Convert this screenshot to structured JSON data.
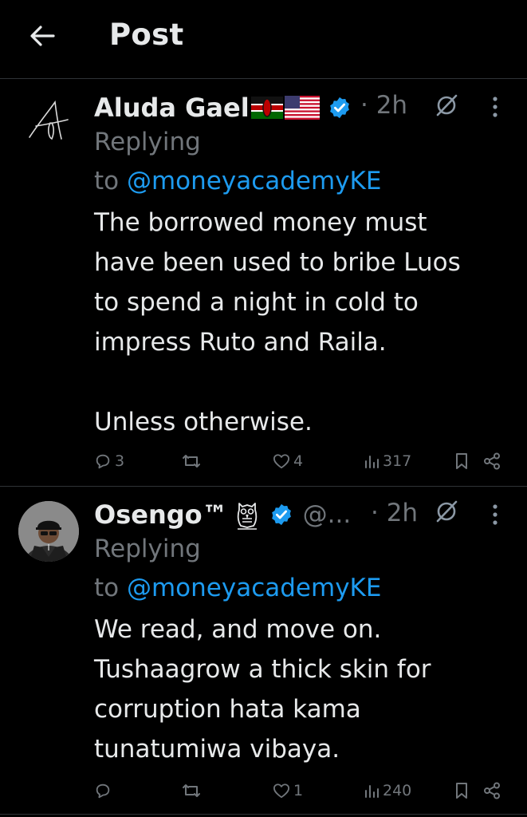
{
  "header": {
    "title": "Post"
  },
  "tweets": [
    {
      "name": "Aluda Gael",
      "handle": "",
      "time": "· 2h",
      "replying": "Replying",
      "to_prefix": "to",
      "mention": "@moneyacademyKE",
      "lines": [
        "The borrowed money must",
        "have been used to bribe Luos",
        "to spend a night in cold to",
        "impress Ruto and Raila.",
        "",
        "Unless otherwise."
      ],
      "replies": "3",
      "reposts": "",
      "likes": "4",
      "views": "317"
    },
    {
      "name": "Osengo™",
      "handle": "@...",
      "time": "· 2h",
      "replying": "Replying",
      "to_prefix": "to",
      "mention": "@moneyacademyKE",
      "lines": [
        "We read, and move on.",
        "Tushaagrow a thick skin for",
        "corruption hata kama",
        "tunatumiwa vibaya."
      ],
      "replies": "",
      "reposts": "",
      "likes": "1",
      "views": "240"
    }
  ],
  "colors": {
    "accent": "#1d9bf0",
    "text": "#e7e9ea",
    "muted": "#71767b",
    "divider": "#2f3336",
    "background": "#000000"
  },
  "icons": [
    "back-arrow-icon",
    "verified-badge-icon",
    "grok-icon",
    "more-icon",
    "reply-icon",
    "repost-icon",
    "like-icon",
    "views-icon",
    "bookmark-icon",
    "share-icon"
  ]
}
